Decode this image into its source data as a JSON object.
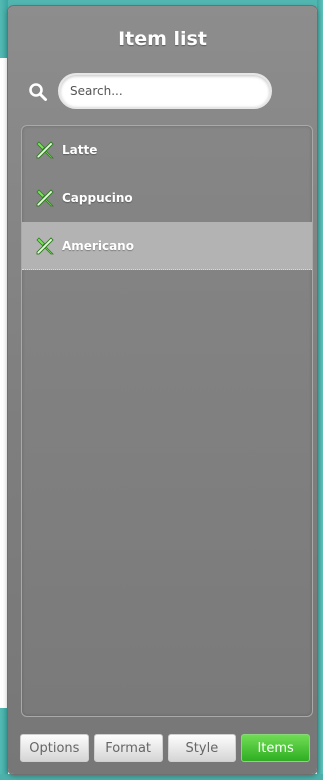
{
  "header": {
    "title": "Item list"
  },
  "search": {
    "placeholder": "Search..."
  },
  "list": {
    "items": [
      {
        "label": "Latte",
        "icon": "edit-tools-icon",
        "selected": false
      },
      {
        "label": "Cappucino",
        "icon": "edit-tools-icon",
        "selected": false
      },
      {
        "label": "Americano",
        "icon": "edit-tools-icon",
        "selected": true
      }
    ]
  },
  "tabs": [
    {
      "label": "Options",
      "active": false
    },
    {
      "label": "Format",
      "active": false
    },
    {
      "label": "Style",
      "active": false
    },
    {
      "label": "Items",
      "active": true
    }
  ],
  "colors": {
    "panel_bg": "#808080",
    "selected_row": "#b3b3b3",
    "active_tab": "#3cbf2c",
    "backdrop": "#4fb4ae"
  }
}
